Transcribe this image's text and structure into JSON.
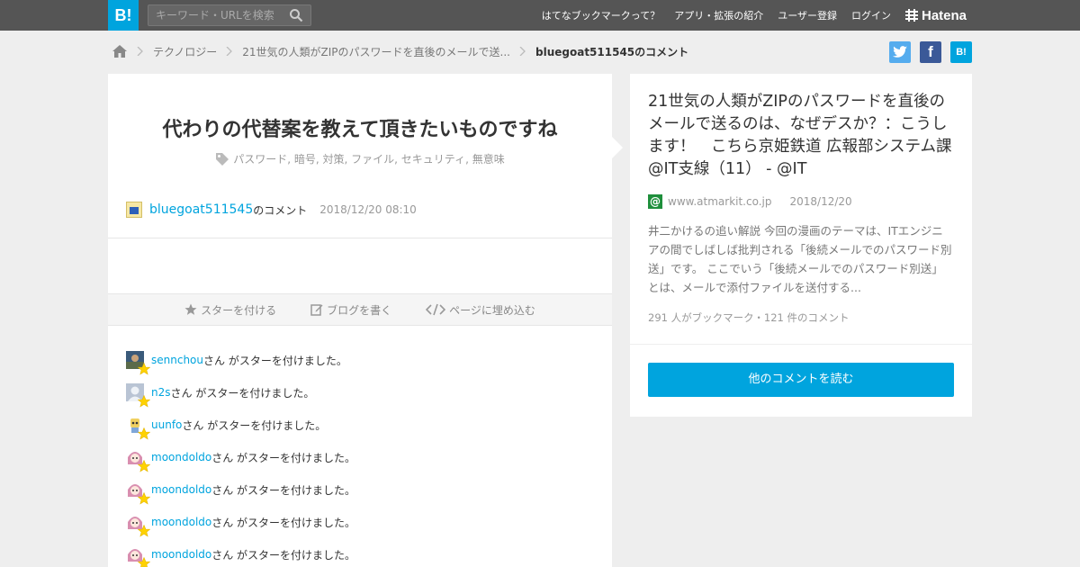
{
  "header": {
    "logo": "B!",
    "search_placeholder": "キーワード・URLを検索",
    "nav": [
      "はてなブックマークって？",
      "アプリ・拡張の紹介",
      "ユーザー登録",
      "ログイン"
    ],
    "hatena_brand": "Hatena"
  },
  "breadcrumb": {
    "items": [
      "テクノロジー",
      "21世気の人類がZIPのパスワードを直後のメールで送..."
    ],
    "current": "bluegoat511545のコメント"
  },
  "share": {
    "twitter": "twitter",
    "facebook": "f",
    "hatebu": "B!"
  },
  "comment": {
    "title": "代わりの代替案を教えて頂きたいものですね",
    "tags": "パスワード,  暗号,  対策,  ファイル,  セキュリティ,  無意味",
    "user": "bluegoat511545",
    "user_suffix": "のコメント",
    "date": "2018/12/20 08:10"
  },
  "actions": {
    "star": "スターを付ける",
    "blog": "ブログを書く",
    "embed": "ページに埋め込む"
  },
  "star_suffix": "さん がスターを付けました。",
  "stars": [
    {
      "user": "sennchou",
      "avatar": "photo-avatar"
    },
    {
      "user": "n2s",
      "avatar": "default-avatar"
    },
    {
      "user": "uunfo",
      "avatar": "character-avatar"
    },
    {
      "user": "moondoldo",
      "avatar": "anime-avatar"
    },
    {
      "user": "moondoldo",
      "avatar": "anime-avatar"
    },
    {
      "user": "moondoldo",
      "avatar": "anime-avatar"
    },
    {
      "user": "moondoldo",
      "avatar": "anime-avatar"
    }
  ],
  "entry": {
    "title": "21世気の人類がZIPのパスワードを直後のメールで送るのは、なぜデスか？：こうします！　こちら京姫鉄道 広報部システム課 @IT支線（11） - @IT",
    "domain": "www.atmarkit.co.jp",
    "date": "2018/12/20",
    "excerpt": "井二かけるの追い解説 今回の漫画のテーマは、ITエンジニアの間でしばしば批判される「後続メールでのパスワード別送」です。 ここでいう「後続メールでのパスワード別送」とは、メールで添付ファイルを送付する...",
    "counts": "291 人がブックマーク・121 件のコメント",
    "read_more": "他のコメントを読む"
  },
  "colors": {
    "accent": "#00a4de",
    "topbar": "#555555",
    "star": "#ffd200"
  }
}
